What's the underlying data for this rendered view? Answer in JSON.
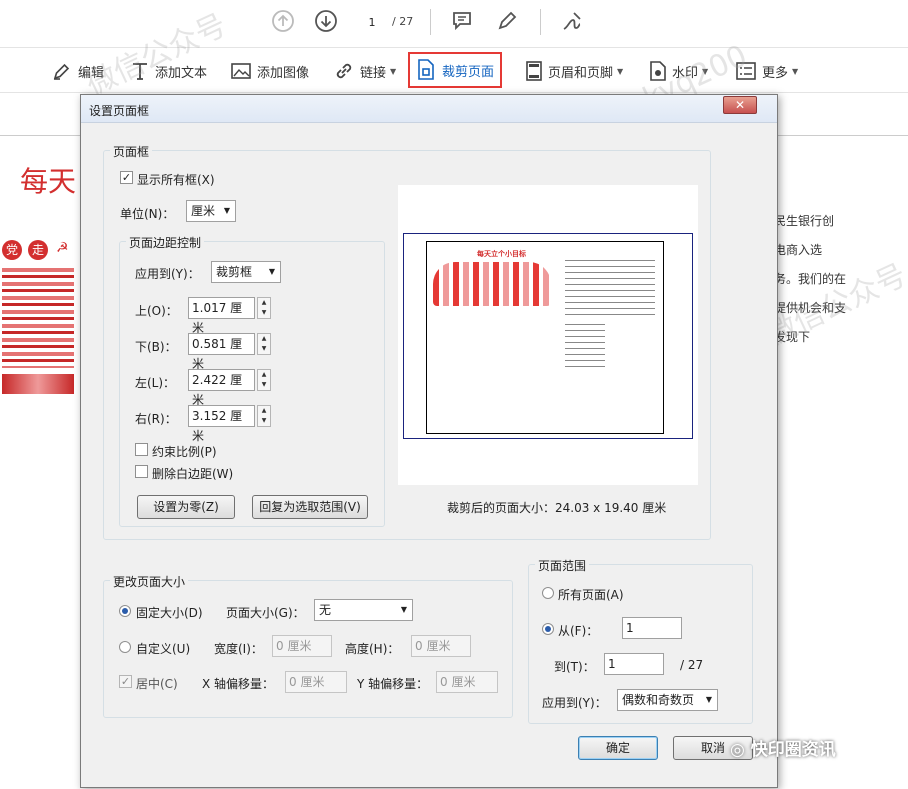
{
  "nav": {
    "page_current": "1",
    "page_total": "/ 27"
  },
  "toolbar": {
    "edit": "编辑",
    "add_text": "添加文本",
    "add_image": "添加图像",
    "link": "链接",
    "crop_page": "裁剪页面",
    "header_footer": "页眉和页脚",
    "watermark": "水印",
    "more": "更多"
  },
  "background": {
    "doc_title": "每天",
    "text_lines": [
      "民生银行创",
      "电商入选",
      "务。我们的在",
      "提供机会和支",
      "发现下"
    ],
    "thumb_badges": [
      "党",
      "走"
    ]
  },
  "dialog": {
    "title": "设置页面框",
    "close": "✕",
    "page_box": {
      "group_label": "页面框",
      "show_all": "显示所有框(X)",
      "unit_label": "单位(N)：",
      "unit_value": "厘米",
      "margin_group": "页面边距控制",
      "apply_to_label": "应用到(Y)：",
      "apply_to_value": "裁剪框",
      "top_label": "上(O)：",
      "top_value": "1.017 厘米",
      "bottom_label": "下(B)：",
      "bottom_value": "0.581 厘米",
      "left_label": "左(L)：",
      "left_value": "2.422 厘米",
      "right_label": "右(R)：",
      "right_value": "3.152 厘米",
      "constrain": "约束比例(P)",
      "remove_white": "删除白边距(W)",
      "set_zero": "设置为零(Z)",
      "revert": "回复为选取范围(V)"
    },
    "preview": {
      "caption": "裁剪后的页面大小：24.03 x 19.40 厘米",
      "thumb_title": "每天立个小目标"
    },
    "change_size": {
      "group_label": "更改页面大小",
      "fixed": "固定大小(D)",
      "page_size_label": "页面大小(G)：",
      "page_size_value": "无",
      "custom": "自定义(U)",
      "width_label": "宽度(I)：",
      "width_value": "0 厘米",
      "height_label": "高度(H)：",
      "height_value": "0 厘米",
      "center": "居中(C)",
      "x_offset_label": "X 轴偏移量：",
      "x_offset_value": "0 厘米",
      "y_offset_label": "Y 轴偏移量：",
      "y_offset_value": "0 厘米"
    },
    "page_range": {
      "group_label": "页面范围",
      "all": "所有页面(A)",
      "from_label": "从(F)：",
      "from_value": "1",
      "to_label": "到(T)：",
      "to_value": "1",
      "total": "/ 27",
      "apply_label": "应用到(Y)：",
      "apply_value": "偶数和奇数页"
    },
    "ok": "确定",
    "cancel": "取消"
  },
  "overlay": {
    "watermark_1": "微信公众号",
    "watermark_2": "“快印圈资讯”",
    "watermark_3": "kyq200",
    "wechat_badge": "快印圈资讯"
  }
}
